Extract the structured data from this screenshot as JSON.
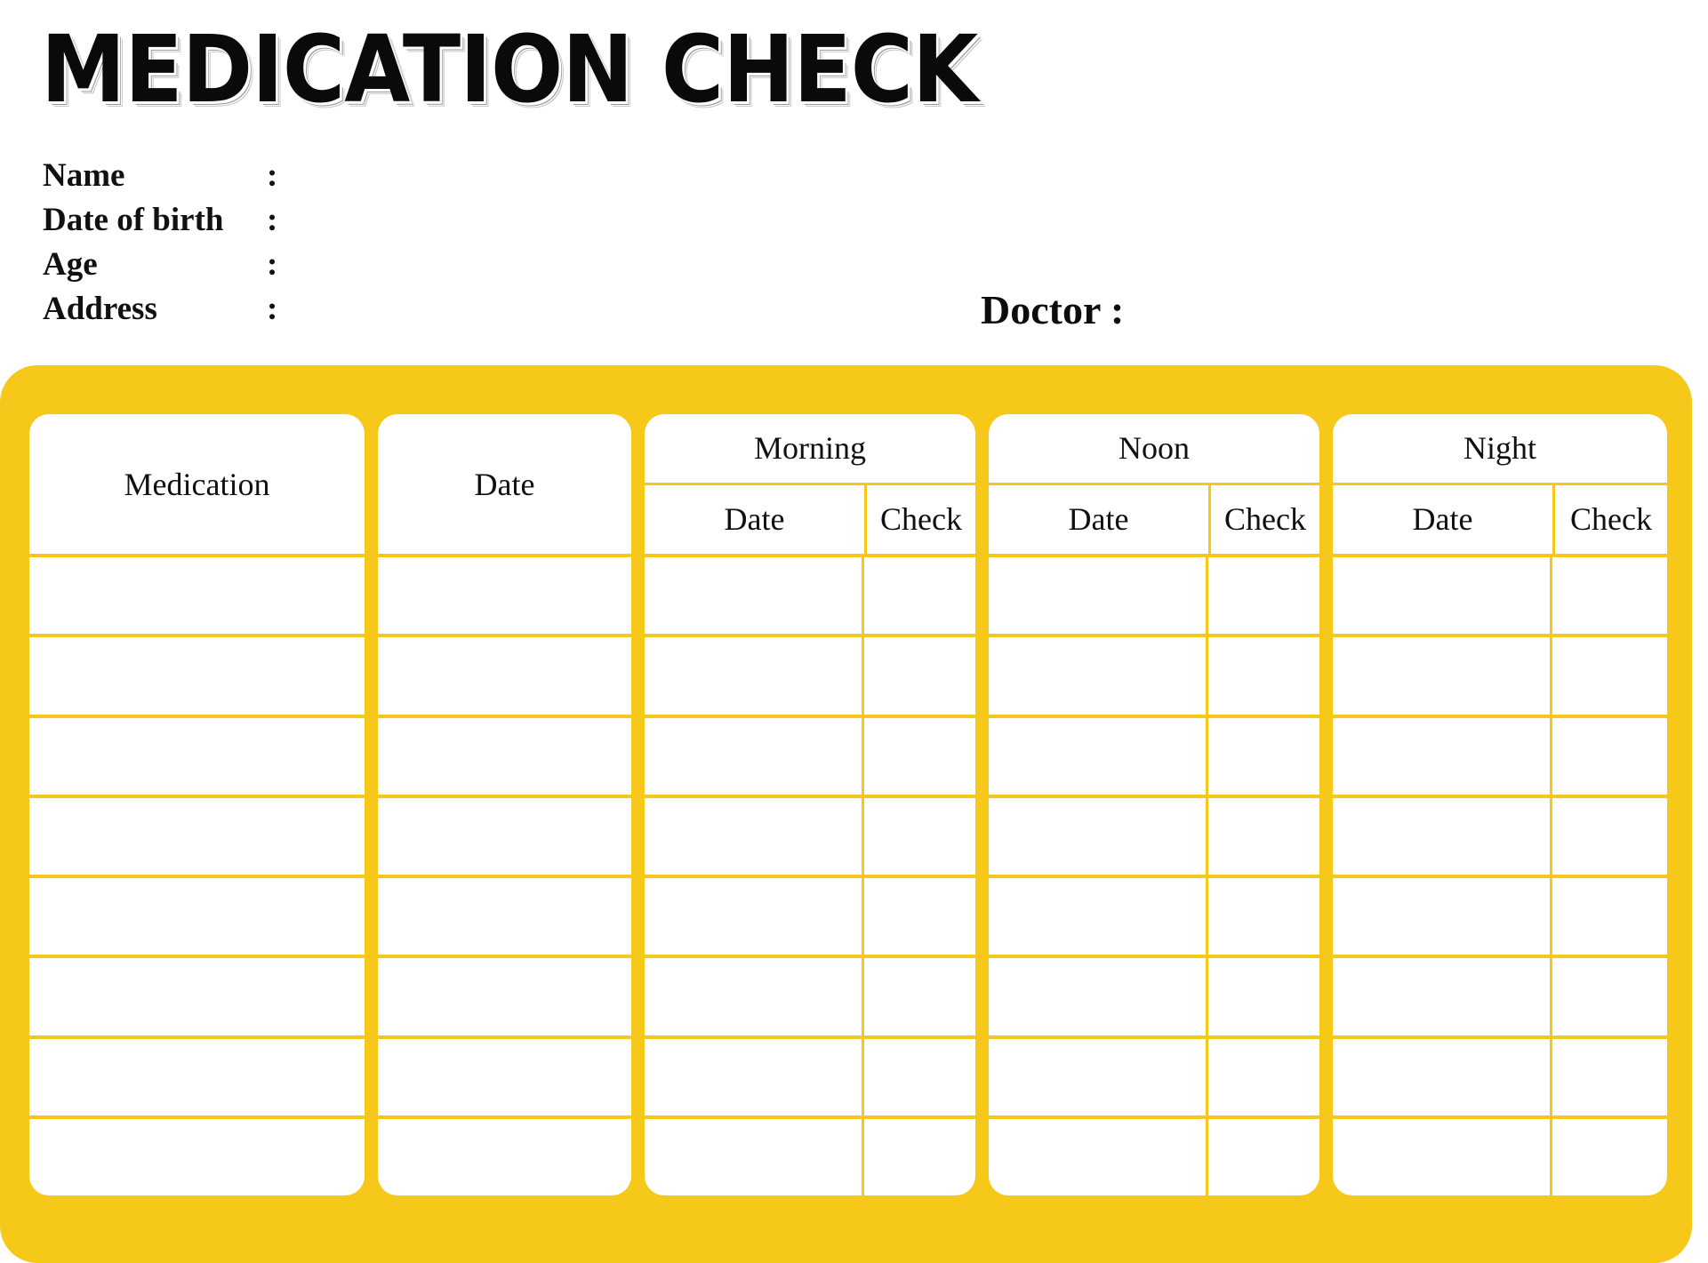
{
  "title": "MEDICATION CHECK",
  "patient": {
    "fields": [
      {
        "label": "Name",
        "colon": ":",
        "value": ""
      },
      {
        "label": "Date of birth",
        "colon": ":",
        "value": ""
      },
      {
        "label": "Age",
        "colon": ":",
        "value": ""
      },
      {
        "label": "Address",
        "colon": ":",
        "value": ""
      }
    ]
  },
  "doctor": {
    "label": "Doctor :",
    "value": ""
  },
  "theme": {
    "accent": "#F6C81A",
    "card": "#FFFFFF",
    "text": "#101010"
  },
  "table": {
    "columns": {
      "medication": "Medication",
      "date": "Date",
      "morning": "Morning",
      "noon": "Noon",
      "night": "Night",
      "sub_date": "Date",
      "sub_check": "Check"
    },
    "row_count": 8,
    "rows": [
      {
        "medication": "",
        "date": "",
        "morning_date": "",
        "morning_check": "",
        "noon_date": "",
        "noon_check": "",
        "night_date": "",
        "night_check": ""
      },
      {
        "medication": "",
        "date": "",
        "morning_date": "",
        "morning_check": "",
        "noon_date": "",
        "noon_check": "",
        "night_date": "",
        "night_check": ""
      },
      {
        "medication": "",
        "date": "",
        "morning_date": "",
        "morning_check": "",
        "noon_date": "",
        "noon_check": "",
        "night_date": "",
        "night_check": ""
      },
      {
        "medication": "",
        "date": "",
        "morning_date": "",
        "morning_check": "",
        "noon_date": "",
        "noon_check": "",
        "night_date": "",
        "night_check": ""
      },
      {
        "medication": "",
        "date": "",
        "morning_date": "",
        "morning_check": "",
        "noon_date": "",
        "noon_check": "",
        "night_date": "",
        "night_check": ""
      },
      {
        "medication": "",
        "date": "",
        "morning_date": "",
        "morning_check": "",
        "noon_date": "",
        "noon_check": "",
        "night_date": "",
        "night_check": ""
      },
      {
        "medication": "",
        "date": "",
        "morning_date": "",
        "morning_check": "",
        "noon_date": "",
        "noon_check": "",
        "night_date": "",
        "night_check": ""
      },
      {
        "medication": "",
        "date": "",
        "morning_date": "",
        "morning_check": "",
        "noon_date": "",
        "noon_check": "",
        "night_date": "",
        "night_check": ""
      }
    ]
  }
}
